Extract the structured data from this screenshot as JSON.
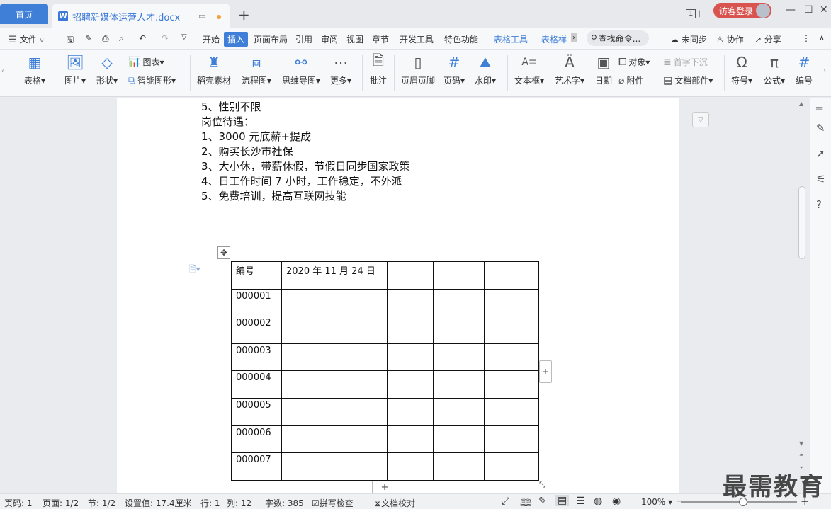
{
  "titlebar": {
    "home_tab": "首页",
    "doc_tab": "招聘新媒体运营人才.docx",
    "doc_icon": "W",
    "new_tab": "+",
    "page_badge": "1",
    "login": "访客登录",
    "min": "—",
    "max": "☐",
    "close": "✕"
  },
  "menubar": {
    "file": "文件",
    "items": [
      "开始",
      "插入",
      "页面布局",
      "引用",
      "审阅",
      "视图",
      "章节",
      "开发工具",
      "特色功能"
    ],
    "active": "插入",
    "context": [
      "表格工具",
      "表格样"
    ],
    "search": "查找命令...",
    "sync": "未同步",
    "collab": "协作",
    "share": "分享"
  },
  "ribbon": {
    "table": "表格",
    "picture": "图片",
    "shape": "形状",
    "chart": "图表",
    "smartart": "智能图形",
    "daoke": "稻壳素材",
    "flowchart": "流程图",
    "mindmap": "思维导图",
    "more": "更多",
    "comment": "批注",
    "header_footer": "页眉页脚",
    "page_num": "页码",
    "watermark": "水印",
    "textbox": "文本框",
    "wordart": "艺术字",
    "date": "日期",
    "object": "对象",
    "attachment": "附件",
    "dropcap": "首字下沉",
    "docparts": "文档部件",
    "symbol": "符号",
    "formula": "公式",
    "numbering": "编号"
  },
  "document": {
    "lines": [
      "5、性别不限",
      "岗位待遇：",
      "1、3000 元底薪+提成",
      "2、购买长沙市社保",
      "3、大小休，带薪休假，节假日同步国家政策",
      "4、日工作时间 7 小时，工作稳定，不外派",
      "5、免费培训，提高互联网技能"
    ],
    "table": {
      "header": [
        "编号",
        "2020 年 11 月 24 日",
        "",
        "",
        ""
      ],
      "rows": [
        [
          "000001",
          "",
          "",
          "",
          ""
        ],
        [
          "000002",
          "",
          "",
          "",
          ""
        ],
        [
          "000003",
          "",
          "",
          "",
          ""
        ],
        [
          "000004",
          "",
          "",
          "",
          ""
        ],
        [
          "000005",
          "",
          "",
          "",
          ""
        ],
        [
          "000006",
          "",
          "",
          "",
          ""
        ],
        [
          "000007",
          "",
          "",
          "",
          ""
        ]
      ]
    }
  },
  "status": {
    "page": "页码: 1",
    "pages": "页面: 1/2",
    "section": "节: 1/2",
    "setting": "设置值: 17.4厘米",
    "row": "行: 1",
    "col": "列: 12",
    "words": "字数: 385",
    "spell": "拼写检查",
    "proof": "文档校对",
    "zoom": "100%"
  },
  "watermark_text": "最需教育"
}
